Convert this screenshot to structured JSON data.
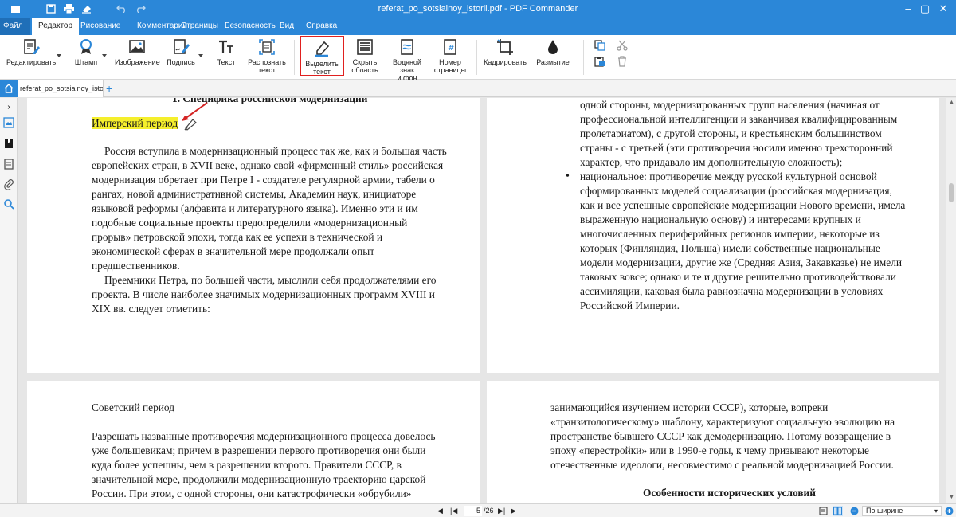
{
  "window": {
    "title": "referat_po_sotsialnoy_istorii.pdf - PDF Commander"
  },
  "menu": {
    "file": "Файл",
    "tabs": [
      "Редактор",
      "Рисование",
      "Комментарии",
      "Страницы",
      "Безопасность",
      "Вид",
      "Справка"
    ]
  },
  "ribbon": {
    "edit": "Редактировать",
    "stamp": "Штамп",
    "image": "Изображение",
    "signature": "Подпись",
    "text": "Текст",
    "ocr_l1": "Распознать",
    "ocr_l2": "текст",
    "highlight_l1": "Выделить",
    "highlight_l2": "текст",
    "hide_l1": "Скрыть",
    "hide_l2": "область",
    "watermark_l1": "Водяной знак",
    "watermark_l2": "и фон",
    "pagenum_l1": "Номер",
    "pagenum_l2": "страницы",
    "crop": "Кадрировать",
    "blur": "Размытие"
  },
  "tabs": {
    "doc_tab": "referat_po_sotsialnoy_istor...",
    "close": "×",
    "add": "+"
  },
  "page1": {
    "cut_heading": "1. Специфика российской модернизации",
    "heading": "Имперский период",
    "p1": [
      "Россия вступила в модернизационный процесс так же, как и большая часть",
      "европейских стран, в XVII веке, однако свой «фирменный стиль» российская",
      "модернизация обретает при Петре I - создателе регулярной армии, табели о",
      "рангах, новой административной системы, Академии наук, инициаторе",
      "языковой реформы (алфавита и литературного языка). Именно эти и им",
      "подобные социальные проекты предопределили «модернизационный",
      "прорыв» петровской эпохи, тогда как ее успехи в технической и",
      "экономической сферах в значительной мере продолжали опыт",
      "предшественников."
    ],
    "p2": [
      "Преемники Петра, по большей части, мыслили себя продолжателями его",
      "проекта. В числе наиболее значимых модернизационных программ XVIII и",
      "XIX вв. следует отметить:"
    ]
  },
  "page2": {
    "lines_a": [
      "одной стороны, модернизированных групп населения (начиная от",
      "профессиональной интеллигенции и заканчивая квалифицированным",
      "пролетариатом), с другой стороны, и крестьянским большинством",
      "страны - с третьей (эти противоречия носили именно трехсторонний",
      "характер, что придавало им дополнительную сложность);"
    ],
    "lines_b": [
      "национальное: противоречие между русской культурной основой",
      "сформированных моделей социализации (российская модернизация,",
      "как и все успешные европейские модернизации Нового времени, имела",
      "выраженную национальную основу) и интересами крупных и",
      "многочисленных периферийных регионов империи, некоторые из",
      "которых (Финляндия, Польша) имели собственные национальные",
      "модели модернизации, другие же (Средняя Азия, Закавказье) не имели",
      "таковых вовсе; однако и те и другие решительно противодействовали",
      "ассимиляции, каковая была равнозначна модернизации в условиях",
      "Российской Империи."
    ]
  },
  "page3": {
    "heading": "Советский период",
    "lines": [
      "Разрешать названные противоречия модернизационного процесса довелось",
      "уже большевикам; причем в разрешении первого противоречия они были",
      "куда более успешны, чем в разрешении второго. Правители СССР, в",
      "значительной мере, продолжили модернизационную траекторию царской",
      "России. При этом, с одной стороны, они катастрофически «обрубили»"
    ]
  },
  "page4": {
    "lines": [
      "занимающийся изучением истории СССР), которые, вопреки",
      "«транзитологическому» шаблону, характеризуют социальную эволюцию на",
      "пространстве бывшего СССР как демодернизацию. Потому возвращение в",
      "эпоху «перестройки» или в 1990-е годы, к чему призывают некоторые",
      "отечественные идеологи, несовместимо с реальной модернизацией России."
    ],
    "heading": "Особенности исторических условий"
  },
  "status": {
    "current_page": "5",
    "total_pages": "/26",
    "zoom": "По ширине"
  },
  "colors": {
    "accent": "#2b87d8",
    "highlight": "#f5ef2c",
    "frame": "#e0201f"
  }
}
